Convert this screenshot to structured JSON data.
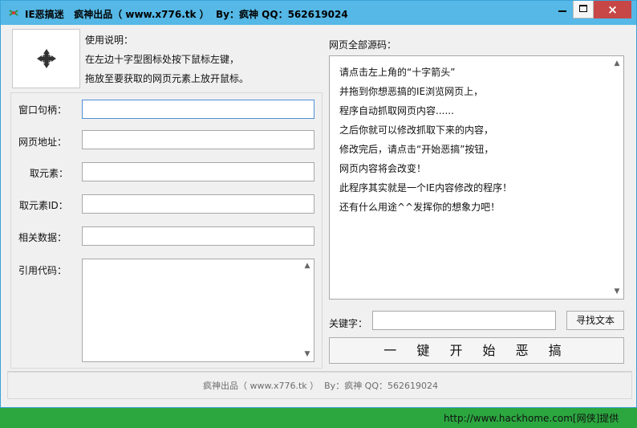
{
  "window": {
    "title": "IE恶搞迷   疯神出品（ www.x776.tk ）  By：疯神 QQ：562619024",
    "close_label": "×"
  },
  "instructions": {
    "heading": "使用说明：",
    "line1": "在左边十字型图标处按下鼠标左键，",
    "line2": "拖放至要获取的网页元素上放开鼠标。"
  },
  "fields": {
    "window_handle_label": "窗口句柄：",
    "web_address_label": "网页地址：",
    "get_element_label": "取元素：",
    "element_id_label": "取元素ID：",
    "related_data_label": "相关数据：",
    "reference_code_label": "引用代码："
  },
  "source": {
    "title": "网页全部源码：",
    "lines": [
      "请点击左上角的“十字箭头”",
      "并拖到你想恶搞的IE浏览网页上，",
      "程序自动抓取网页内容......",
      "之后你就可以修改抓取下来的内容，",
      "修改完后，请点击“开始恶搞”按钮，",
      "网页内容将会改变！",
      "此程序其实就是一个IE内容修改的程序！",
      "还有什么用途^^发挥你的想象力吧！"
    ]
  },
  "search": {
    "keyword_label": "关键字：",
    "keyword_value": "",
    "find_button_label": "寻找文本"
  },
  "actions": {
    "start_button_label": "一 键 开 始 恶 搞"
  },
  "footer": {
    "text": "疯神出品（ www.x776.tk ）  By：疯神 QQ：562619024"
  },
  "bottom_bar": {
    "link_text": "http://www.hackhome.com[网侠]提供"
  },
  "icons": {
    "app_icon": "bug-icon",
    "cross_icon": "cross-arrow-icon",
    "minimize_icon": "minimize-icon",
    "maximize_icon": "maximize-icon",
    "close_icon": "close-icon"
  },
  "colors": {
    "titlebar": "#55b8e6",
    "close_button": "#c74747",
    "bottom_bar": "#2ca740"
  }
}
